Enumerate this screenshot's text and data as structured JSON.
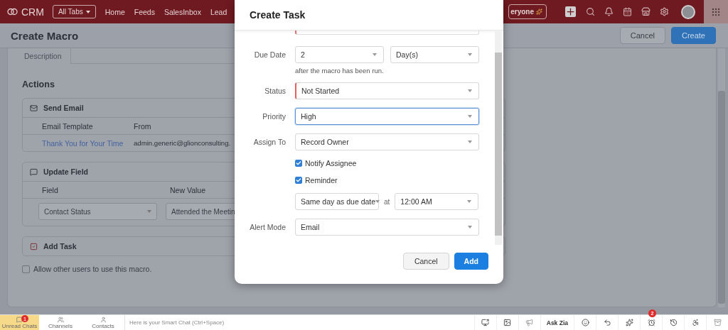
{
  "top_bar": {
    "app_name": "CRM",
    "all_tabs": "All Tabs",
    "nav": [
      "Home",
      "Feeds",
      "SalesInbox",
      "Lead"
    ],
    "chip": "eryone"
  },
  "page_header": {
    "title": "Create Macro",
    "buttons": [
      {
        "label": "Cancel",
        "kind": "secondary"
      },
      {
        "label": "Create",
        "kind": "primary"
      }
    ]
  },
  "form": {
    "description_label": "Description",
    "actions_title": "Actions",
    "sections": [
      {
        "kind": "email",
        "title": "Send Email",
        "columns": [
          "Email Template",
          "From"
        ],
        "row": [
          "Thank You for Your Time",
          "admin.generic@glionconsulting."
        ]
      },
      {
        "kind": "update",
        "title": "Update Field",
        "columns": [
          "Field",
          "New Value"
        ],
        "row": [
          "Contact Status",
          "Attended the Meetin"
        ]
      },
      {
        "kind": "task",
        "title": "Add Task"
      }
    ],
    "allow_others": {
      "label": "Allow other users to use this macro.",
      "checked": false
    }
  },
  "dialog": {
    "title": "Create Task",
    "rows": [
      {
        "kind": "due",
        "label": "Due Date",
        "value": "2",
        "unit": "Day(s)",
        "hint": "after the macro has been run."
      },
      {
        "kind": "select",
        "label": "Status",
        "value": "Not Started",
        "required": true,
        "focused": false
      },
      {
        "kind": "select",
        "label": "Priority",
        "value": "High",
        "required": false,
        "focused": true
      },
      {
        "kind": "select",
        "label": "Assign To",
        "value": "Record Owner",
        "required": false,
        "focused": false
      },
      {
        "kind": "checkbox",
        "label": "Notify Assignee",
        "checked": true
      },
      {
        "kind": "checkbox",
        "label": "Reminder",
        "checked": true
      },
      {
        "kind": "reminder",
        "value": "Same day as due date",
        "joiner": "at",
        "time": "12:00 AM"
      },
      {
        "kind": "select",
        "label": "Alert Mode",
        "value": "Email",
        "required": false,
        "focused": false
      }
    ],
    "buttons": [
      {
        "label": "Cancel",
        "kind": "secondary"
      },
      {
        "label": "Add",
        "kind": "primary"
      }
    ]
  },
  "bottom_bar": {
    "tabs": [
      {
        "label": "Unread Chats",
        "selected": true,
        "badge": "1"
      },
      {
        "label": "Channels",
        "selected": false
      },
      {
        "label": "Contacts",
        "selected": false
      }
    ],
    "chat_placeholder": "Here is your Smart Chat (Ctrl+Space)",
    "ask_zia": "Ask Zia",
    "alarm_badge": "2"
  }
}
